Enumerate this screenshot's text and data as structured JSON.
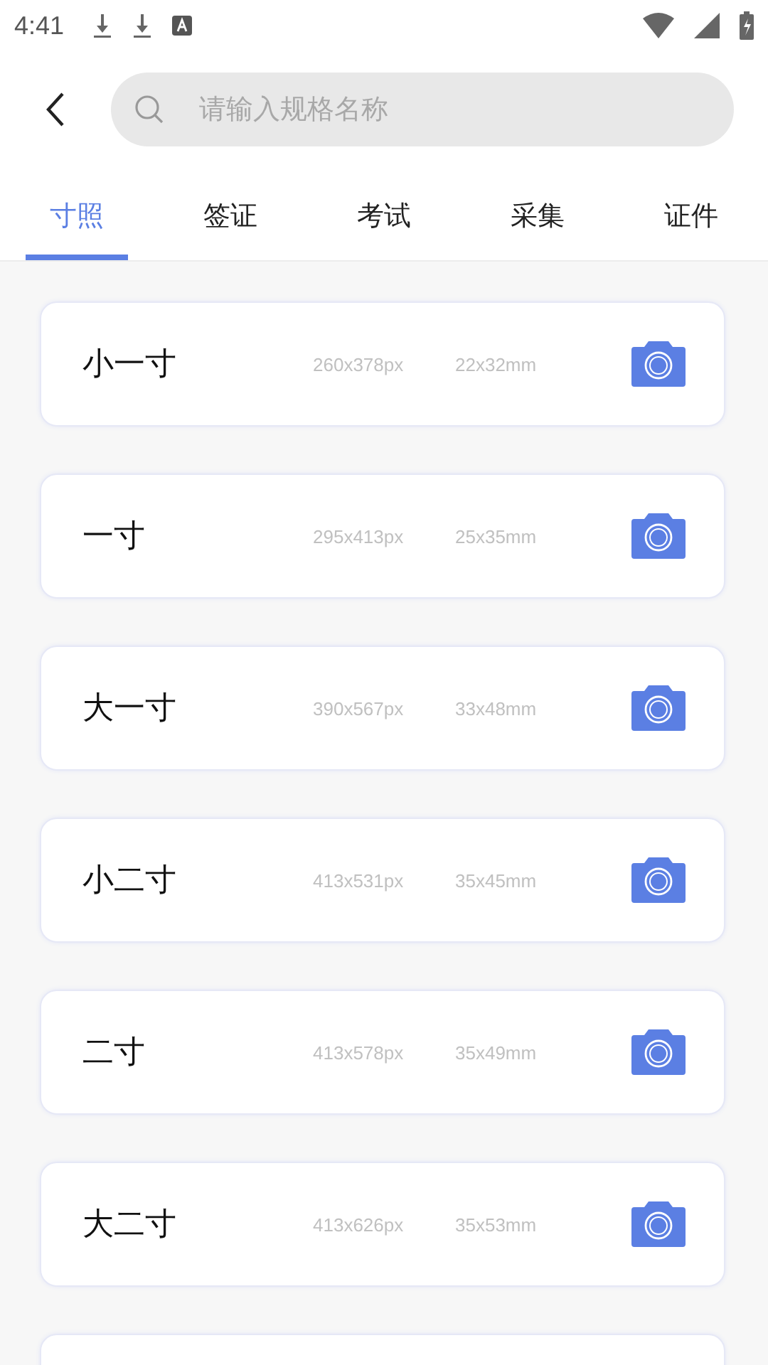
{
  "status_bar": {
    "time": "4:41"
  },
  "search": {
    "placeholder": "请输入规格名称"
  },
  "tabs": [
    {
      "label": "寸照",
      "selected": true
    },
    {
      "label": "签证",
      "selected": false
    },
    {
      "label": "考试",
      "selected": false
    },
    {
      "label": "采集",
      "selected": false
    },
    {
      "label": "证件",
      "selected": false
    }
  ],
  "specs": [
    {
      "name": "小一寸",
      "pixels": "260x378px",
      "size": "22x32mm"
    },
    {
      "name": "一寸",
      "pixels": "295x413px",
      "size": "25x35mm"
    },
    {
      "name": "大一寸",
      "pixels": "390x567px",
      "size": "33x48mm"
    },
    {
      "name": "小二寸",
      "pixels": "413x531px",
      "size": "35x45mm"
    },
    {
      "name": "二寸",
      "pixels": "413x578px",
      "size": "35x49mm"
    },
    {
      "name": "大二寸",
      "pixels": "413x626px",
      "size": "35x53mm"
    }
  ]
}
